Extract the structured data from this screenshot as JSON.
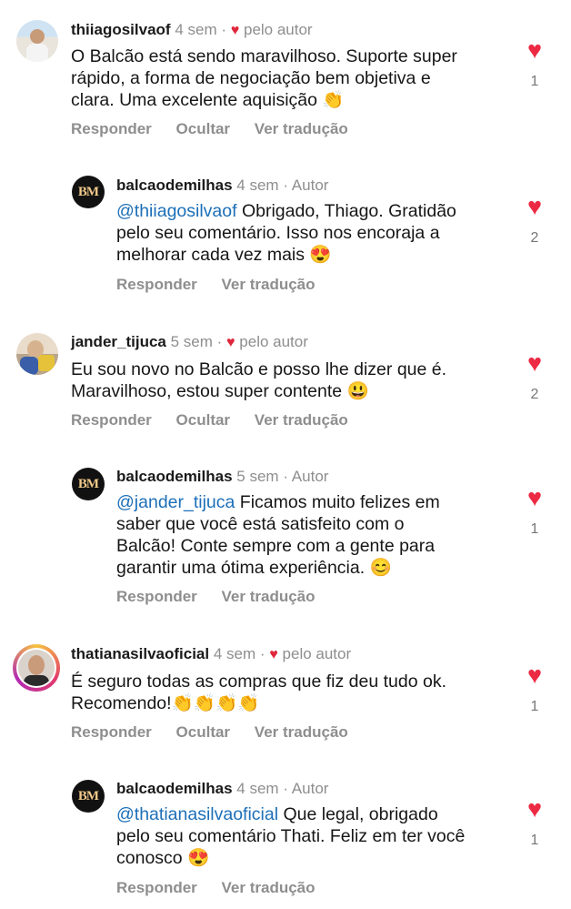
{
  "comments": [
    {
      "username": "thiiagosilvaof",
      "time": "4 sem",
      "tag": "pelo autor",
      "lines": [
        "O Balcão está sendo maravilhoso. Suporte super",
        "rápido, a forma de negociação bem objetiva e",
        "clara. Uma excelente aquisição 👏"
      ],
      "actions": [
        "Responder",
        "Ocultar",
        "Ver tradução"
      ],
      "likes": "1"
    },
    {
      "username": "balcaodemilhas",
      "time": "4 sem",
      "tag": "Autor",
      "mention": "@thiiagosilvaof",
      "lines": [
        " Obrigado, Thiago. Gratidão",
        "pelo seu comentário. Isso nos encoraja a",
        "melhorar cada vez mais 😍"
      ],
      "actions": [
        "Responder",
        "Ver tradução"
      ],
      "likes": "2"
    },
    {
      "username": "jander_tijuca",
      "time": "5 sem",
      "tag": "pelo autor",
      "lines": [
        "Eu sou novo no Balcão e posso lhe dizer que é.",
        "Maravilhoso, estou super contente 😃"
      ],
      "actions": [
        "Responder",
        "Ocultar",
        "Ver tradução"
      ],
      "likes": "2"
    },
    {
      "username": "balcaodemilhas",
      "time": "5 sem",
      "tag": "Autor",
      "mention": "@jander_tijuca",
      "lines": [
        " Ficamos muito felizes em",
        "saber que você está satisfeito com o",
        "Balcão! Conte sempre com a gente para",
        "garantir uma ótima experiência. 😊"
      ],
      "actions": [
        "Responder",
        "Ver tradução"
      ],
      "likes": "1"
    },
    {
      "username": "thatianasilvaoficial",
      "time": "4 sem",
      "tag": "pelo autor",
      "lines": [
        "É seguro todas as compras que fiz deu tudo ok.",
        "Recomendo!👏👏👏👏"
      ],
      "actions": [
        "Responder",
        "Ocultar",
        "Ver tradução"
      ],
      "likes": "1"
    },
    {
      "username": "balcaodemilhas",
      "time": "4 sem",
      "tag": "Autor",
      "mention": "@thatianasilvaoficial",
      "lines": [
        " Que legal, obrigado",
        "pelo seu comentário Thati. Feliz em ter você",
        "conosco 😍"
      ],
      "actions": [
        "Responder",
        "Ver tradução"
      ],
      "likes": "1"
    }
  ],
  "brand_mark": "BM",
  "dot": "·",
  "colors": {
    "heart": "#ec2a43",
    "mention": "#1c6fb8",
    "muted": "#8e8e8e"
  }
}
